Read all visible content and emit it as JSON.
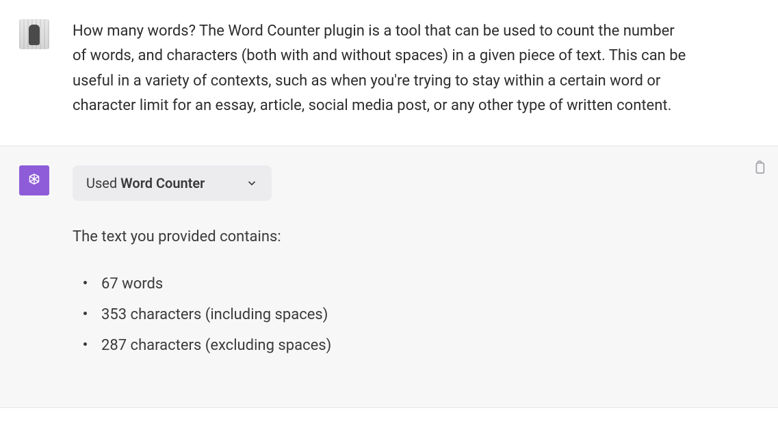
{
  "user": {
    "message": "How many words? The Word Counter plugin is a tool that can be used to count the number of words, and characters (both with and without spaces) in a given piece of text. This can be useful in a variety of contexts, such as when you're trying to stay within a certain word or character limit for an essay, article, social media post, or any other type of written content."
  },
  "assistant": {
    "plugin_used_prefix": "Used ",
    "plugin_used_name": "Word Counter",
    "lead": "The text you provided contains:",
    "results": [
      "67 words",
      "353 characters (including spaces)",
      "287 characters (excluding spaces)"
    ]
  },
  "colors": {
    "assistant_avatar_bg": "#8e5cd9"
  }
}
